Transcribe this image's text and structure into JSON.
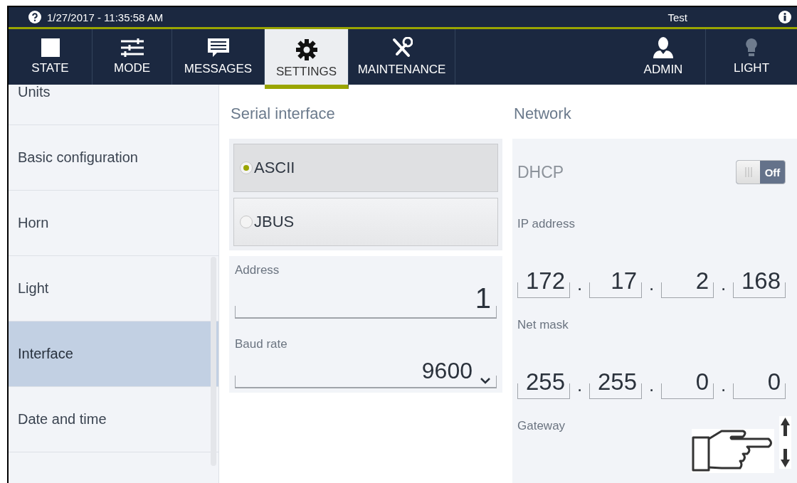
{
  "status_bar": {
    "datetime": "1/27/2017 - 11:35:58 AM",
    "user": "Test"
  },
  "nav_tabs": [
    {
      "label": "STATE",
      "selected": false
    },
    {
      "label": "MODE",
      "selected": false
    },
    {
      "label": "MESSAGES",
      "selected": false
    },
    {
      "label": "SETTINGS",
      "selected": true
    },
    {
      "label": "MAINTENANCE",
      "selected": false
    }
  ],
  "right_tabs": [
    {
      "label": "ADMIN"
    },
    {
      "label": "LIGHT"
    }
  ],
  "sidebar": {
    "items": [
      {
        "label": "Units",
        "selected": false
      },
      {
        "label": "Basic configuration",
        "selected": false
      },
      {
        "label": "Horn",
        "selected": false
      },
      {
        "label": "Light",
        "selected": false
      },
      {
        "label": "Interface",
        "selected": true
      },
      {
        "label": "Date and time",
        "selected": false
      }
    ]
  },
  "serial": {
    "title": "Serial interface",
    "options": [
      {
        "label": "ASCII",
        "selected": true
      },
      {
        "label": "JBUS",
        "selected": false
      }
    ],
    "address": {
      "label": "Address",
      "value": "1"
    },
    "baud_rate": {
      "label": "Baud rate",
      "value": "9600"
    }
  },
  "network": {
    "title": "Network",
    "dhcp": {
      "label": "DHCP",
      "on": false,
      "state_text": "Off"
    },
    "fields": [
      {
        "label": "IP address",
        "separator": ".",
        "octets": [
          "172",
          "17",
          "2",
          "168"
        ]
      },
      {
        "label": "Net mask",
        "separator": ".",
        "octets": [
          "255",
          "255",
          "0",
          "0"
        ]
      },
      {
        "label": "Gateway"
      }
    ]
  }
}
